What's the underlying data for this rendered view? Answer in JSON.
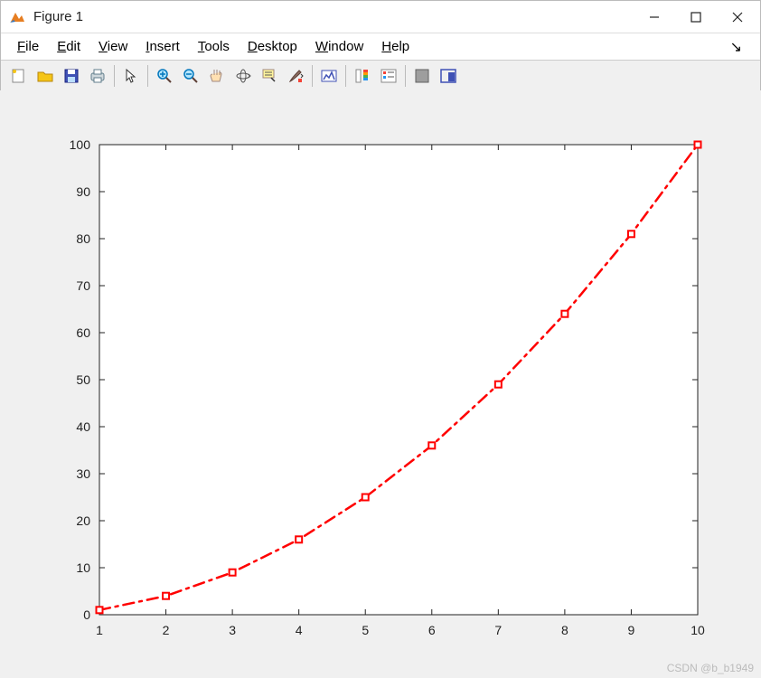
{
  "window": {
    "title": "Figure 1"
  },
  "menus": {
    "items": [
      {
        "label": "File",
        "hotkey": "F"
      },
      {
        "label": "Edit",
        "hotkey": "E"
      },
      {
        "label": "View",
        "hotkey": "V"
      },
      {
        "label": "Insert",
        "hotkey": "I"
      },
      {
        "label": "Tools",
        "hotkey": "T"
      },
      {
        "label": "Desktop",
        "hotkey": "D"
      },
      {
        "label": "Window",
        "hotkey": "W"
      },
      {
        "label": "Help",
        "hotkey": "H"
      }
    ]
  },
  "toolbar": {
    "buttons": [
      "new-figure-icon",
      "open-icon",
      "save-icon",
      "print-icon",
      "sep",
      "cursor-icon",
      "sep",
      "zoom-in-icon",
      "zoom-out-icon",
      "pan-icon",
      "rotate3d-icon",
      "data-cursor-icon",
      "brush-icon",
      "sep",
      "link-plot-icon",
      "sep",
      "colorbar-icon",
      "legend-icon",
      "sep",
      "hide-tools-icon",
      "dock-icon"
    ]
  },
  "watermark": "CSDN @b_b1949",
  "chart_data": {
    "type": "line",
    "x": [
      1,
      2,
      3,
      4,
      5,
      6,
      7,
      8,
      9,
      10
    ],
    "y": [
      1,
      4,
      9,
      16,
      25,
      36,
      49,
      64,
      81,
      100
    ],
    "xticks": [
      1,
      2,
      3,
      4,
      5,
      6,
      7,
      8,
      9,
      10
    ],
    "yticks": [
      0,
      10,
      20,
      30,
      40,
      50,
      60,
      70,
      80,
      90,
      100
    ],
    "xlim": [
      1,
      10
    ],
    "ylim": [
      0,
      100
    ],
    "title": "",
    "xlabel": "",
    "ylabel": "",
    "line_style": "dash-dot",
    "line_color": "#FF0000",
    "marker": "square",
    "marker_face_color": "#FFFFFF",
    "marker_edge_color": "#FF0000",
    "marker_size": 7,
    "grid": false
  }
}
